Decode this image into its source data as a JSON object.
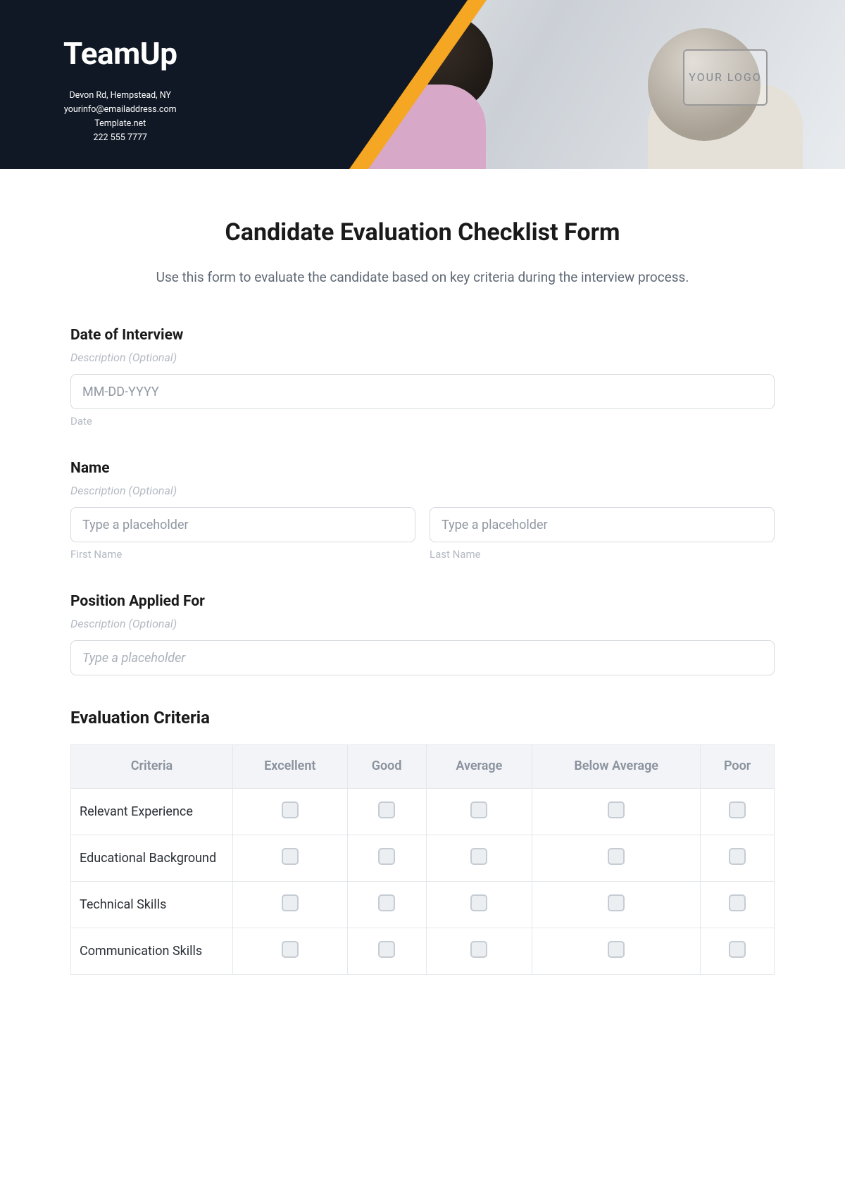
{
  "brand": {
    "name": "TeamUp",
    "address": "Devon Rd, Hempstead, NY",
    "email": "yourinfo@emailaddress.com",
    "site": "Template.net",
    "phone": "222 555 7777",
    "logo_placeholder": "YOUR LOGO"
  },
  "form": {
    "title": "Candidate Evaluation Checklist Form",
    "description": "Use this form to evaluate the candidate based on key criteria during the interview process."
  },
  "fields": {
    "date": {
      "label": "Date of Interview",
      "helper": "Description (Optional)",
      "placeholder": "MM-DD-YYYY",
      "sub": "Date"
    },
    "name": {
      "label": "Name",
      "helper": "Description (Optional)",
      "first_placeholder": "Type a placeholder",
      "last_placeholder": "Type a placeholder",
      "first_sub": "First Name",
      "last_sub": "Last Name"
    },
    "position": {
      "label": "Position Applied For",
      "helper": "Description (Optional)",
      "placeholder": "Type a placeholder"
    }
  },
  "evaluation": {
    "section_title": "Evaluation Criteria",
    "headers": [
      "Criteria",
      "Excellent",
      "Good",
      "Average",
      "Below Average",
      "Poor"
    ],
    "rows": [
      "Relevant Experience",
      "Educational Background",
      "Technical Skills",
      "Communication Skills"
    ]
  }
}
